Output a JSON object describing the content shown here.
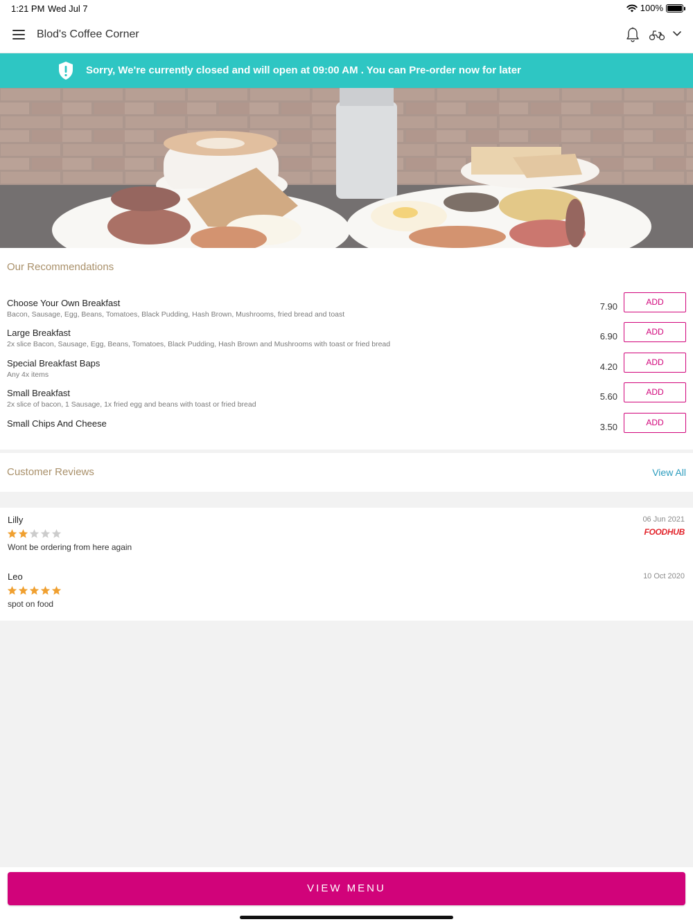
{
  "status_bar": {
    "time": "1:21 PM",
    "date": "Wed Jul 7",
    "battery": "100%"
  },
  "header": {
    "title": "Blod's Coffee Corner"
  },
  "banner": {
    "message": "Sorry, We're currently closed and will open at 09:00 AM . You can Pre-order now for later"
  },
  "recommendations": {
    "title": "Our Recommendations",
    "add_label": "ADD",
    "items": [
      {
        "name": "Choose Your Own Breakfast",
        "description": "Bacon, Sausage, Egg, Beans, Tomatoes, Black Pudding, Hash Brown, Mushrooms, fried bread and toast",
        "price": "7.90"
      },
      {
        "name": "Large Breakfast",
        "description": "2x slice Bacon, Sausage, Egg, Beans, Tomatoes, Black Pudding, Hash Brown and Mushrooms with toast or fried bread",
        "price": "6.90"
      },
      {
        "name": "Special Breakfast Baps",
        "description": "Any 4x items",
        "price": "4.20"
      },
      {
        "name": "Small Breakfast",
        "description": "2x slice of bacon, 1 Sausage, 1x fried egg and beans with toast or fried bread",
        "price": "5.60"
      },
      {
        "name": "Small Chips And Cheese",
        "description": "",
        "price": "3.50"
      }
    ]
  },
  "reviews": {
    "title": "Customer Reviews",
    "view_all": "View All",
    "items": [
      {
        "author": "Lilly",
        "date": "06 Jun 2021",
        "rating": 2,
        "comment": "Wont be ordering from here again",
        "source": "FOODHUB"
      },
      {
        "author": "Leo",
        "date": "10 Oct 2020",
        "rating": 5,
        "comment": "spot on food",
        "source": ""
      }
    ]
  },
  "footer": {
    "view_menu": "VIEW MENU"
  },
  "colors": {
    "accent": "#d1037a",
    "banner": "#2ec6c3",
    "section_title": "#a9906a",
    "link": "#2a9bbd",
    "star_on": "#f0a030",
    "star_off": "#cccccc"
  }
}
